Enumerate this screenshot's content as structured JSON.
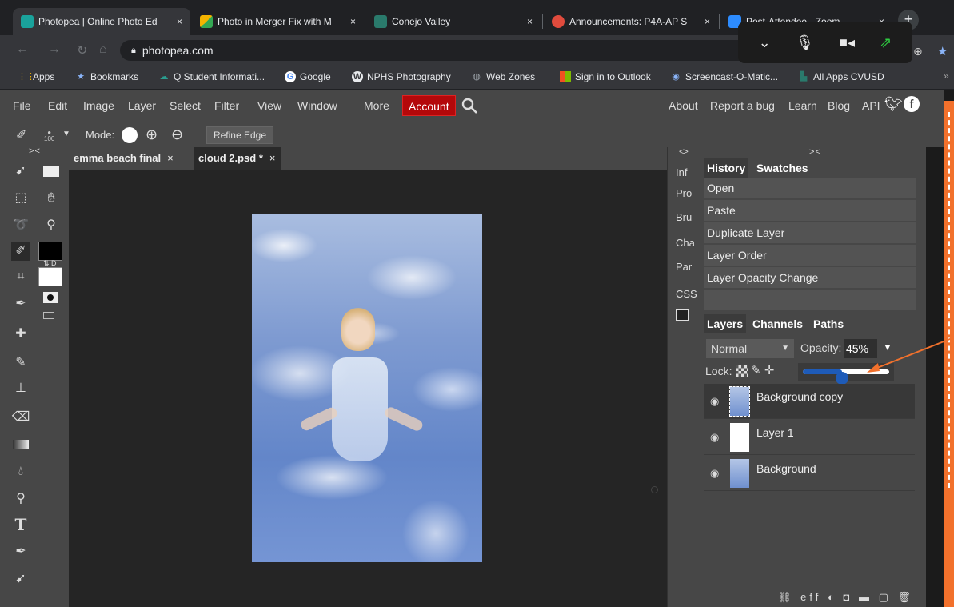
{
  "browser": {
    "tabs": [
      {
        "label": "Photopea | Online Photo Ed",
        "close": "×",
        "color": "#1aa39c",
        "active": true
      },
      {
        "label": "Photo in Merger Fix with M",
        "close": "×",
        "color": "#f4b400",
        "active": false
      },
      {
        "label": "Conejo Valley",
        "close": "×",
        "color": "#2a7a6c",
        "active": false
      },
      {
        "label": "Announcements: P4A-AP S",
        "close": "×",
        "color": "#e04b3d",
        "active": false
      },
      {
        "label": "Post-Attendee - Zoom",
        "close": "×",
        "color": "#2d8cff",
        "active": false
      }
    ],
    "new_tab": "+",
    "url": "photopea.com",
    "bookmarks": [
      {
        "label": "Apps",
        "icon": "apps-grid-icon"
      },
      {
        "label": "Bookmarks",
        "icon": "star-icon"
      },
      {
        "label": "Q Student Informati...",
        "icon": "q-logo-icon"
      },
      {
        "label": "Google",
        "icon": "google-icon"
      },
      {
        "label": "NPHS Photography",
        "icon": "wordpress-icon"
      },
      {
        "label": "Web Zones",
        "icon": "globe-icon"
      },
      {
        "label": "Sign in to Outlook",
        "icon": "microsoft-icon"
      },
      {
        "label": "Screencast-O-Matic...",
        "icon": "screencast-icon"
      },
      {
        "label": "All Apps CVUSD",
        "icon": "school-icon"
      }
    ],
    "bookmarks_more": "»"
  },
  "zoom_controls": [
    "chevron-down-icon",
    "microphone-icon",
    "video-icon",
    "share-screen-icon"
  ],
  "photopea": {
    "menu": [
      "File",
      "Edit",
      "Image",
      "Layer",
      "Select",
      "Filter",
      "View",
      "Window",
      "More"
    ],
    "account": "Account",
    "right_menu": [
      "About",
      "Report a bug",
      "Learn",
      "Blog",
      "API"
    ],
    "options": {
      "mode_label": "Mode:",
      "refine_edge": "Refine Edge",
      "brush_size": "100"
    },
    "doc_tabs": [
      {
        "label": "emma beach final",
        "close": "×",
        "active": false
      },
      {
        "label": "cloud 2.psd *",
        "close": "×",
        "active": true
      }
    ],
    "collapse_label": "> <",
    "side_collapse": "<>",
    "side_items": [
      "Inf",
      "Pro",
      "Bru",
      "Cha",
      "Par",
      "CSS"
    ],
    "panel_tabs_top": [
      "History",
      "Swatches"
    ],
    "history": [
      "Open",
      "Paste",
      "Duplicate Layer",
      "Layer Order",
      "Layer Opacity Change"
    ],
    "panel_tabs_layers": [
      "Layers",
      "Channels",
      "Paths"
    ],
    "blend_mode": "Normal",
    "opacity_label": "Opacity:",
    "opacity_value": "45%",
    "opacity_fraction": 0.45,
    "lock_label": "Lock:",
    "layers": [
      {
        "name": "Background copy",
        "active": true
      },
      {
        "name": "Layer 1",
        "active": false
      },
      {
        "name": "Background",
        "active": false
      }
    ],
    "swap_label": "D"
  },
  "colors": {
    "accent_orange": "#f2712c",
    "account_red": "#b4080a",
    "slider_blue": "#1e5bb8"
  }
}
